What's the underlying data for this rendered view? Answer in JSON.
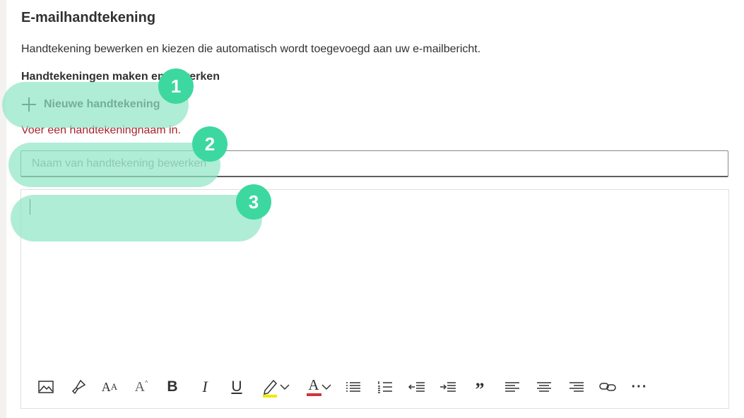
{
  "section": {
    "title": "E-mailhandtekening",
    "description": "Handtekening bewerken en kiezen die automatisch wordt toegevoegd aan uw e-mailbericht.",
    "subheading": "Handtekeningen maken en bewerken",
    "new_signature_label": "Nieuwe handtekening",
    "error_message": "Voer een handtekeningnaam in.",
    "name_placeholder": "Naam van handtekening bewerken",
    "name_value": ""
  },
  "toolbar": {
    "font_size_glyph": "A",
    "bold_glyph": "B",
    "italic_glyph": "I",
    "underline_glyph": "U",
    "font_color_glyph": "A",
    "quote_glyph": "”",
    "more_glyph": "···",
    "highlight_color": "#f1e800",
    "font_color": "#d13438"
  },
  "callouts": [
    "1",
    "2",
    "3"
  ],
  "colors": {
    "accent": "#3dd89f",
    "highlight": "#8fe6c4",
    "error": "#a4262c"
  }
}
